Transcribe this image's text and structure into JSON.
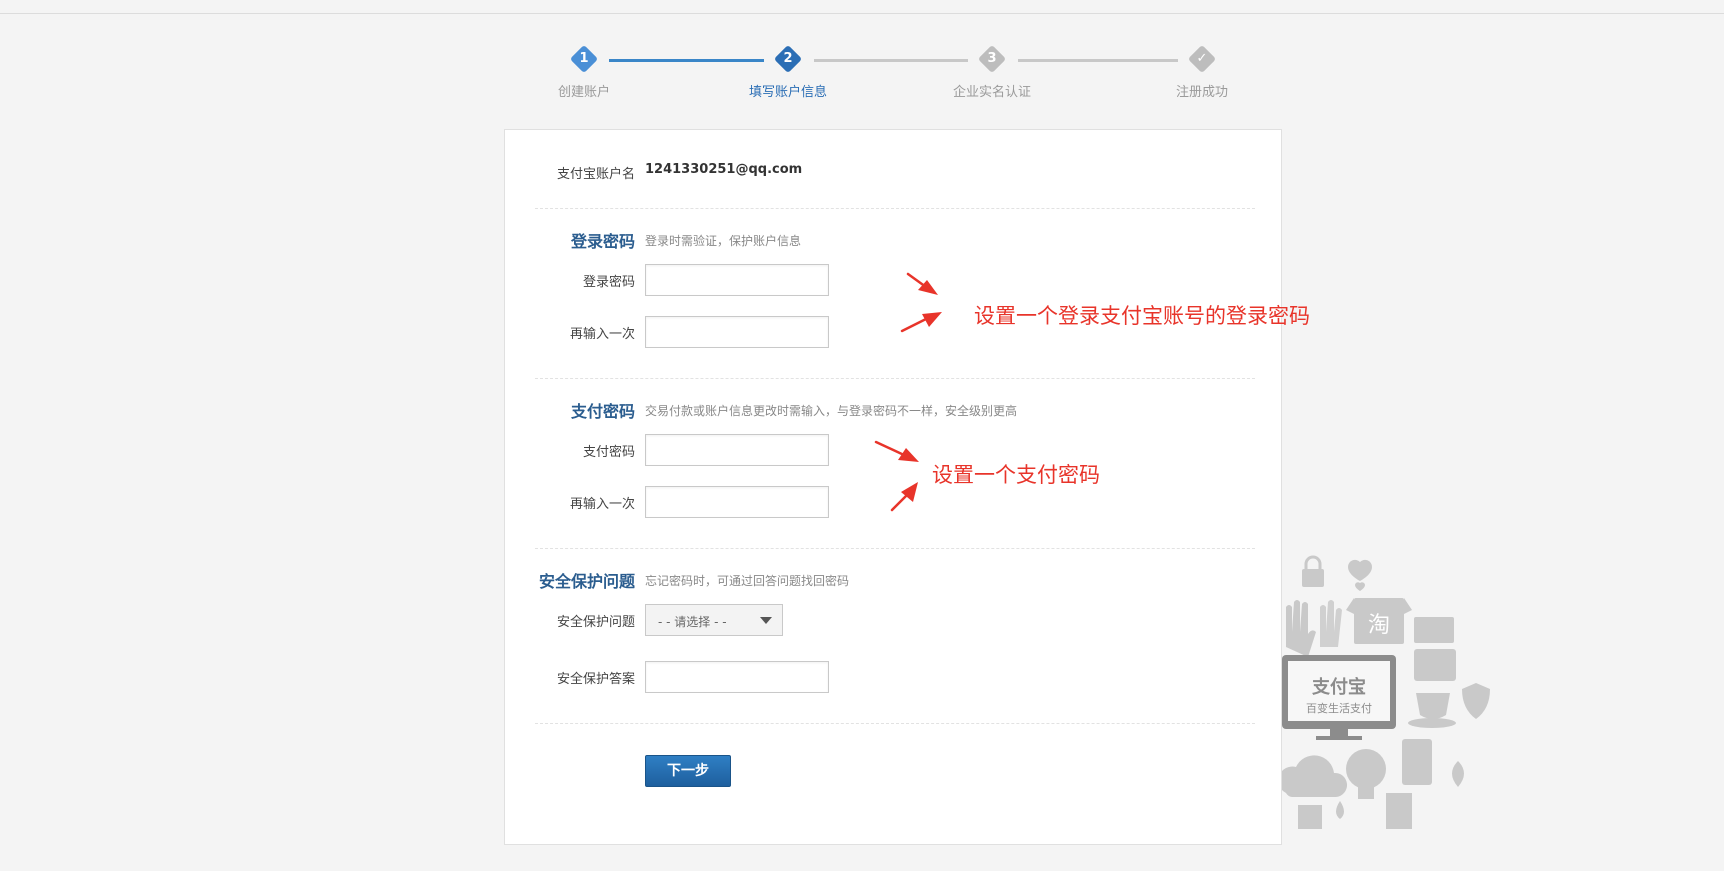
{
  "steps": [
    {
      "num": "1",
      "label": "创建账户"
    },
    {
      "num": "2",
      "label": "填写账户信息"
    },
    {
      "num": "3",
      "label": "企业实名认证"
    },
    {
      "num": "✓",
      "label": "注册成功"
    }
  ],
  "account": {
    "label": "支付宝账户名",
    "value": "1241330251@qq.com"
  },
  "login_section": {
    "title": "登录密码",
    "hint": "登录时需验证，保护账户信息",
    "password_label": "登录密码",
    "confirm_label": "再输入一次",
    "password_value": "",
    "confirm_value": ""
  },
  "pay_section": {
    "title": "支付密码",
    "hint": "交易付款或账户信息更改时需输入，与登录密码不一样，安全级别更高",
    "password_label": "支付密码",
    "confirm_label": "再输入一次",
    "password_value": "",
    "confirm_value": ""
  },
  "security_section": {
    "title": "安全保护问题",
    "hint": "忘记密码时，可通过回答问题找回密码",
    "question_label": "安全保护问题",
    "question_value": "- - 请选择 - -",
    "answer_label": "安全保护答案",
    "answer_value": ""
  },
  "next_button": "下一步",
  "annotations": {
    "login": "设置一个登录支付宝账号的登录密码",
    "pay": "设置一个支付密码"
  },
  "illustration": {
    "brand": "支付宝",
    "tagline": "百变生活支付",
    "tao_char": "淘"
  },
  "colors": {
    "accent": "#2b6eb5",
    "annotation_red": "#e8342a",
    "step_inactive": "#bdbdbd"
  }
}
